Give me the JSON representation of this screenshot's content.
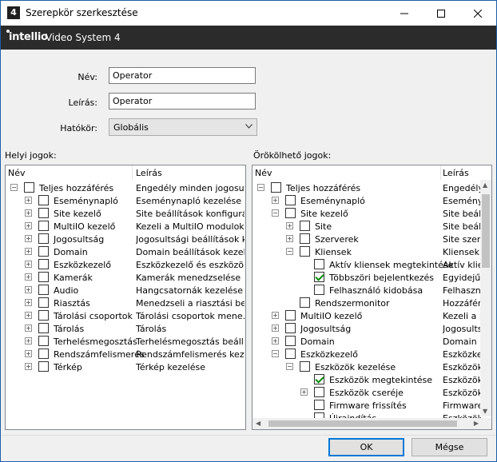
{
  "window": {
    "title": "Szerepkör szerkesztése",
    "icon_text": "4"
  },
  "brand": {
    "logo": "intellio",
    "product": "Video System 4"
  },
  "form": {
    "name_label": "Név:",
    "name_value": "Operator",
    "desc_label": "Leírás:",
    "desc_value": "Operator",
    "scope_label": "Hatókör:",
    "scope_value": "Globális"
  },
  "local": {
    "title": "Helyi jogok:",
    "col_name": "Név",
    "col_desc": "Leírás",
    "rows": [
      {
        "name": "Teljes hozzáférés",
        "desc": "Engedély minden jogosul...",
        "level": 0,
        "toggle": "⊟"
      },
      {
        "name": "Eseménynapló",
        "desc": "Eseménynapló kezelése",
        "level": 1,
        "toggle": "⊞"
      },
      {
        "name": "Site kezelő",
        "desc": "Site beállítások konfigurál...",
        "level": 1,
        "toggle": "⊞"
      },
      {
        "name": "MultiIO kezelő",
        "desc": "Kezeli a MultiIO modulok ...",
        "level": 1,
        "toggle": "⊞"
      },
      {
        "name": "Jogosultság",
        "desc": "Jogosultsági beállítások k...",
        "level": 1,
        "toggle": "⊞"
      },
      {
        "name": "Domain",
        "desc": "Domain beállítások kezelése",
        "level": 1,
        "toggle": "⊞"
      },
      {
        "name": "Eszközkezelő",
        "desc": "Eszközkezelő és eszközö...",
        "level": 1,
        "toggle": "⊞"
      },
      {
        "name": "Kamerák",
        "desc": "Kamerák menedzselése",
        "level": 1,
        "toggle": "⊞"
      },
      {
        "name": "Audio",
        "desc": "Hangcsatornák kezelése",
        "level": 1,
        "toggle": "⊞"
      },
      {
        "name": "Riasztás",
        "desc": "Menedzseli a riasztási be...",
        "level": 1,
        "toggle": "⊞"
      },
      {
        "name": "Tárolási csoportok",
        "desc": "Tárolási csoportok mene...",
        "level": 1,
        "toggle": "⊞"
      },
      {
        "name": "Tárolás",
        "desc": "Tárolás",
        "level": 1,
        "toggle": "⊞"
      },
      {
        "name": "Terhelésmegosztás",
        "desc": "Terhelésmegosztás beállí...",
        "level": 1,
        "toggle": "⊞"
      },
      {
        "name": "Rendszámfelismerés",
        "desc": "Rendszámfelismerés kez...",
        "level": 1,
        "toggle": "⊞"
      },
      {
        "name": "Térkép",
        "desc": "Térkép kezelése",
        "level": 1,
        "toggle": "⊞"
      }
    ]
  },
  "inherited": {
    "title": "Örökölhető jogok:",
    "col_name": "Név",
    "col_desc": "Leírás",
    "rows": [
      {
        "name": "Teljes hozzáférés",
        "desc": "Engedély",
        "level": 0,
        "toggle": "⊟",
        "checked": false
      },
      {
        "name": "Eseménynapló",
        "desc": "Eseményn",
        "level": 1,
        "toggle": "⊞",
        "checked": false
      },
      {
        "name": "Site kezelő",
        "desc": "Site beállít",
        "level": 1,
        "toggle": "⊟",
        "checked": false
      },
      {
        "name": "Site",
        "desc": "Site beállít",
        "level": 2,
        "toggle": "⊞",
        "checked": false
      },
      {
        "name": "Szerverek",
        "desc": "Site szerve",
        "level": 2,
        "toggle": "⊞",
        "checked": false
      },
      {
        "name": "Kliensek",
        "desc": "Kliensek",
        "level": 2,
        "toggle": "⊟",
        "checked": false
      },
      {
        "name": "Aktív kliensek megtekintése",
        "desc": "Aktív klien",
        "level": 3,
        "toggle": "",
        "checked": false
      },
      {
        "name": "Többszöri bejelentkezés",
        "desc": "Egyidejűl",
        "level": 3,
        "toggle": "",
        "checked": true
      },
      {
        "name": "Felhasználó kidobása",
        "desc": "Felhasznál",
        "level": 3,
        "toggle": "",
        "checked": false
      },
      {
        "name": "Rendszermonitor",
        "desc": "Hozzáférés",
        "level": 2,
        "toggle": "",
        "checked": false
      },
      {
        "name": "MultiIO kezelő",
        "desc": "Kezeli a M",
        "level": 1,
        "toggle": "⊞",
        "checked": false
      },
      {
        "name": "Jogosultság",
        "desc": "Jogosultság",
        "level": 1,
        "toggle": "⊞",
        "checked": false
      },
      {
        "name": "Domain",
        "desc": "Domain be",
        "level": 1,
        "toggle": "⊞",
        "checked": false
      },
      {
        "name": "Eszközkezelő",
        "desc": "Eszközkez",
        "level": 1,
        "toggle": "⊟",
        "checked": false
      },
      {
        "name": "Eszközök kezelése",
        "desc": "Eszközök",
        "level": 2,
        "toggle": "⊟",
        "checked": false
      },
      {
        "name": "Eszközök megtekintése",
        "desc": "Eszközök",
        "level": 3,
        "toggle": "",
        "checked": true
      },
      {
        "name": "Eszközök cseréje",
        "desc": "Eszközök",
        "level": 3,
        "toggle": "⊞",
        "checked": false
      },
      {
        "name": "Firmware frissítés",
        "desc": "Firmware",
        "level": 3,
        "toggle": "",
        "checked": false
      },
      {
        "name": "Újraindítás",
        "desc": "Eszközök",
        "level": 3,
        "toggle": "",
        "checked": false
      }
    ]
  },
  "buttons": {
    "ok": "OK",
    "cancel": "Mégse"
  },
  "colors": {
    "title_border": "#1d5fa7",
    "brand_bar": "#2b2b2b",
    "check": "#0a8a0a",
    "focus": "#0078d7"
  }
}
